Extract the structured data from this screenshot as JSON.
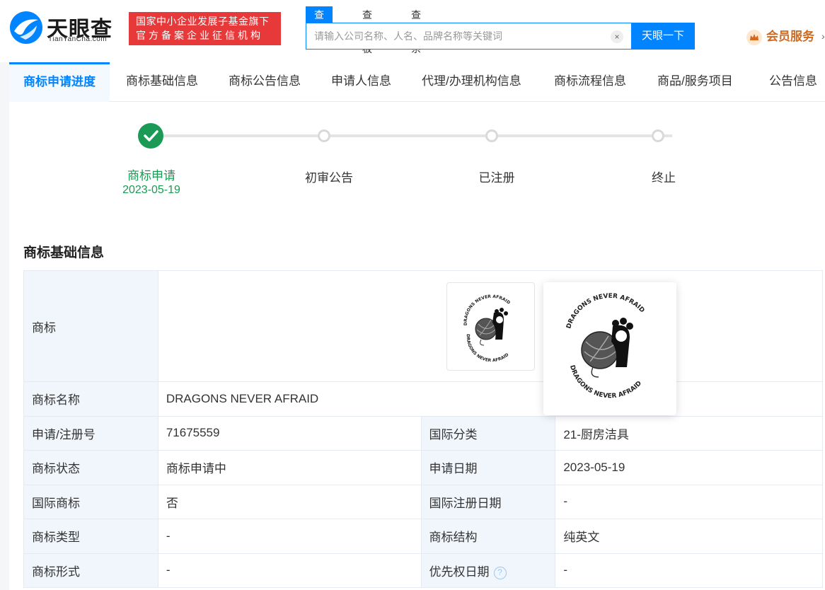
{
  "header": {
    "logo_text": "天眼查",
    "logo_sub": "TianYanCha.com",
    "fund_badge_line1": "国家中小企业发展子基金旗下",
    "fund_badge_line2": "官方备案企业征信机构",
    "search_tabs": [
      "查公司",
      "查老板",
      "查关系"
    ],
    "search_placeholder": "请输入公司名称、人名、品牌名称等关键词",
    "search_button": "天眼一下",
    "vip_label": "会员服务"
  },
  "nav": {
    "tabs": [
      "商标申请进度",
      "商标基础信息",
      "商标公告信息",
      "申请人信息",
      "代理/办理机构信息",
      "商标流程信息",
      "商品/服务项目",
      "公告信息"
    ],
    "active_index": 0
  },
  "progress": {
    "steps": [
      {
        "label": "商标申请",
        "date": "2023-05-19",
        "done": true
      },
      {
        "label": "初审公告",
        "date": "",
        "done": false
      },
      {
        "label": "已注册",
        "date": "",
        "done": false
      },
      {
        "label": "终止",
        "date": "",
        "done": false
      }
    ]
  },
  "basic_info": {
    "title": "商标基础信息",
    "trademark_label": "商标",
    "trademark_text": "DRAGONS NEVER AFRAID",
    "rows": [
      {
        "l1": "商标名称",
        "v1": "DRAGONS NEVER AFRAID"
      },
      {
        "l1": "申请/注册号",
        "v1": "71675559",
        "l2": "国际分类",
        "v2": "21-厨房洁具"
      },
      {
        "l1": "商标状态",
        "v1": "商标申请中",
        "l2": "申请日期",
        "v2": "2023-05-19"
      },
      {
        "l1": "国际商标",
        "v1": "否",
        "l2": "国际注册日期",
        "v2": "-"
      },
      {
        "l1": "商标类型",
        "v1": "-",
        "l2": "商标结构",
        "v2": "纯英文"
      },
      {
        "l1": "商标形式",
        "v1": "-",
        "l2": "优先权日期",
        "v2": "-"
      }
    ]
  },
  "colors": {
    "accent": "#0084ff",
    "success": "#1a9a54",
    "badge_red": "#e8393a",
    "vip": "#d2691e"
  }
}
